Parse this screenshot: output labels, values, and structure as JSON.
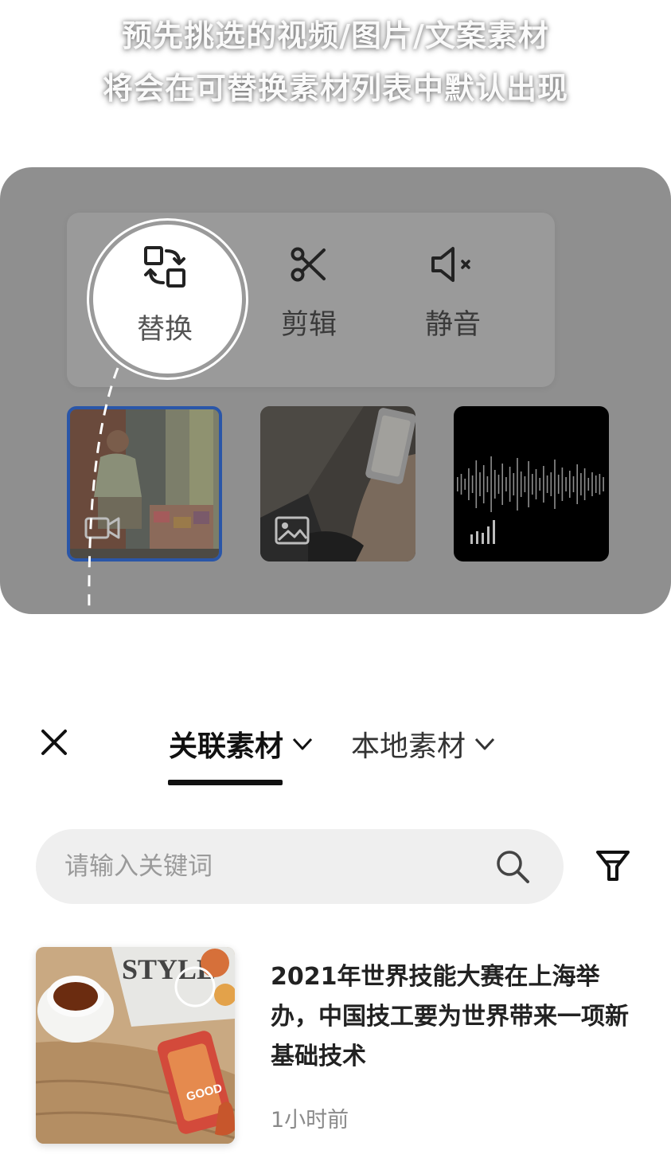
{
  "caption": {
    "line1": "预先挑选的视频/图片/文案素材",
    "line2": "将会在可替换素材列表中默认出现"
  },
  "action_bar": {
    "replace": {
      "label": "替换",
      "icon": "swap-icon"
    },
    "cut": {
      "label": "剪辑",
      "icon": "scissors-icon"
    },
    "mute": {
      "label": "静音",
      "icon": "speaker-mute-icon"
    }
  },
  "material_slots": [
    {
      "type": "video",
      "badge_icon": "video-camera-icon",
      "selected": true
    },
    {
      "type": "image",
      "badge_icon": "image-icon",
      "selected": false
    },
    {
      "type": "audio",
      "badge_icon": "audio-bars-icon",
      "selected": false
    }
  ],
  "picker": {
    "close_icon": "close-icon",
    "tabs": [
      {
        "label": "关联素材",
        "active": true,
        "icon": "chevron-down-icon"
      },
      {
        "label": "本地素材",
        "active": false,
        "icon": "chevron-down-icon"
      }
    ],
    "search": {
      "placeholder": "请输入关键词",
      "value": ""
    },
    "filter_icon": "filter-icon"
  },
  "results": [
    {
      "title": "2021年世界技能大赛在上海举办，中国技工要为世界带来一项新基础技术",
      "time": "1小时前",
      "selected": false
    }
  ],
  "colors": {
    "overlay": "#8f8f8f",
    "selected_border": "#2a56a8",
    "search_bg": "#efefef",
    "text_dark": "#222222",
    "text_muted": "#8a8a8a"
  }
}
